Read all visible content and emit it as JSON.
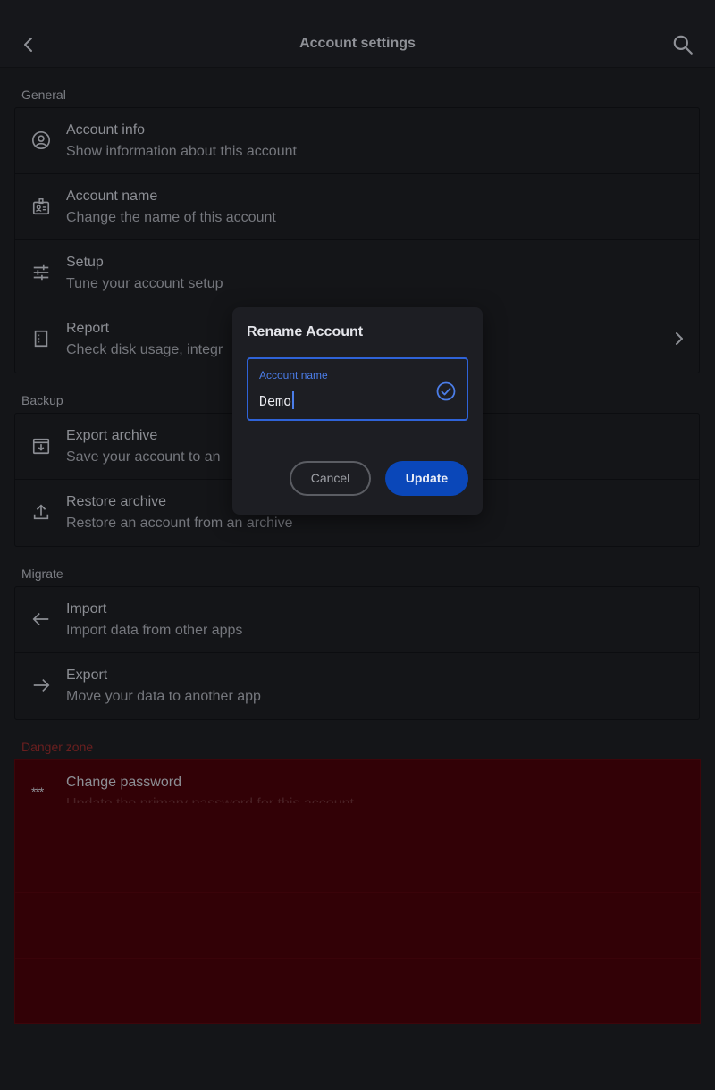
{
  "header": {
    "title": "Account settings",
    "back_icon": "back-arrow-icon",
    "search_icon": "search-icon"
  },
  "sections": {
    "general": {
      "label": "General",
      "items": [
        {
          "title": "Account info",
          "subtitle": "Show information about this account",
          "icon": "account-circle-icon"
        },
        {
          "title": "Account name",
          "subtitle": "Change the name of this account",
          "icon": "badge-icon"
        },
        {
          "title": "Setup",
          "subtitle": "Tune your account setup",
          "icon": "tune-icon"
        },
        {
          "title": "Report",
          "subtitle": "Check disk usage, integr",
          "icon": "report-icon"
        }
      ]
    },
    "backup": {
      "label": "Backup",
      "items": [
        {
          "title": "Export archive",
          "subtitle": "Save your account to an",
          "icon": "archive-icon"
        },
        {
          "title": "Restore archive",
          "subtitle": "Restore an account from an archive",
          "icon": "upload-icon"
        }
      ]
    },
    "migrate": {
      "label": "Migrate",
      "items": [
        {
          "title": "Import",
          "subtitle": "Import data from other apps",
          "icon": "arrow-left-icon"
        },
        {
          "title": "Export",
          "subtitle": "Move your data to another app",
          "icon": "arrow-right-icon"
        }
      ]
    },
    "danger": {
      "label": "Danger zone",
      "items": [
        {
          "title": "Change password",
          "subtitle": "Update the primary password for this account",
          "icon_text": "***"
        }
      ]
    }
  },
  "dialog": {
    "title": "Rename Account",
    "field_label": "Account name",
    "field_value": "Demo",
    "cancel_label": "Cancel",
    "update_label": "Update"
  },
  "colors": {
    "accent": "#2f63d8",
    "update_button": "#0a47b9",
    "danger_bg": "#320106",
    "danger_label": "#6b1f1f"
  }
}
